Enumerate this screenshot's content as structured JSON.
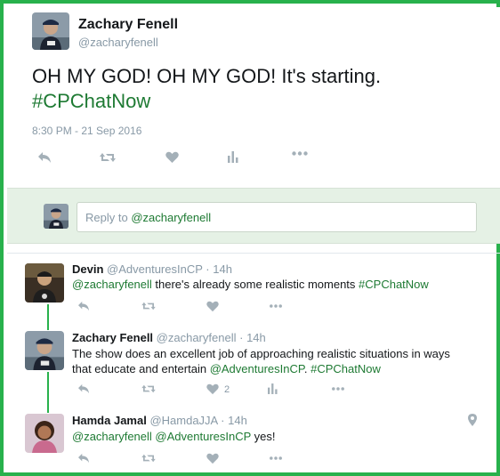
{
  "tweet": {
    "author_name": "Zachary Fenell",
    "author_handle": "@zacharyfenell",
    "text_prefix": "OH MY GOD! OH MY GOD! It's starting.",
    "hashtag": "#CPChatNow",
    "timestamp": "8:30 PM - 21 Sep 2016"
  },
  "reply_box": {
    "prompt": "Reply to ",
    "mention": "@zacharyfenell"
  },
  "replies": [
    {
      "name": "Devin",
      "handle": "@AdventuresInCP",
      "time": "14h",
      "text_mention": "@zacharyfenell",
      "text_body": " there's already some realistic moments ",
      "text_hashtag": "#CPChatNow"
    },
    {
      "name": "Zachary Fenell",
      "handle": "@zacharyfenell",
      "time": "14h",
      "text_body": "The show does an excellent job of approaching realistic situations in ways that educate and entertain ",
      "text_mention": "@AdventuresInCP",
      "text_sep": ". ",
      "text_hashtag": "#CPChatNow",
      "like_count": "2"
    },
    {
      "name": "Hamda Jamal",
      "handle": "@HamdaJJA",
      "time": "14h",
      "text_mention1": "@zacharyfenell",
      "text_sep": " ",
      "text_mention2": "@AdventuresInCP",
      "text_body": " yes!"
    }
  ],
  "meta_separator": "·",
  "icons": {
    "reply": "reply-icon",
    "retweet": "retweet-icon",
    "like": "heart-icon",
    "analytics": "analytics-icon",
    "more": "more-icon",
    "location": "location-pin-icon"
  },
  "colors": {
    "frame_border": "#28b14c",
    "link_green": "#1e7a33",
    "reply_box_bg": "#e5f1e5",
    "muted_text": "#8899a6"
  }
}
